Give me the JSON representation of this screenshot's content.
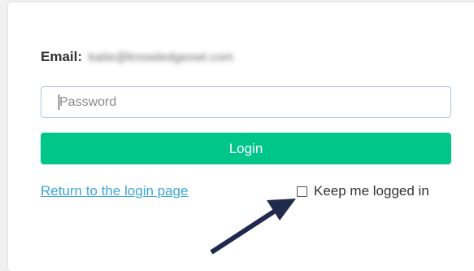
{
  "login_form": {
    "email_label": "Email:",
    "email_value": "katie@knowledgeowl.com",
    "password_placeholder": "Password",
    "password_value": "",
    "login_button_label": "Login",
    "return_link_label": "Return to the login page",
    "keep_logged_in_label": "Keep me logged in",
    "keep_logged_in_checked": false
  },
  "annotation": {
    "icon": "arrow-icon",
    "color": "#1f2a4d"
  },
  "colors": {
    "login_button": "#00c68a",
    "link": "#3aa6d8",
    "input_border": "#a9c7d8"
  }
}
